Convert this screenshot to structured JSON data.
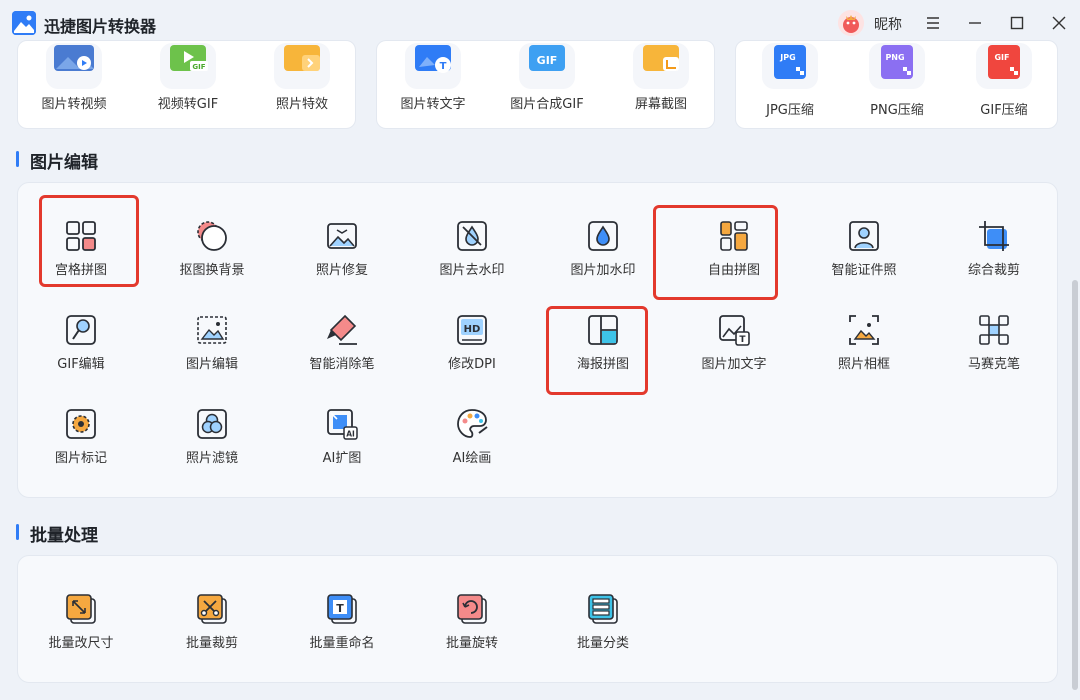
{
  "app": {
    "title": "迅捷图片转换器",
    "nickname": "昵称"
  },
  "colors": {
    "accent": "#2f7cf6",
    "highlight": "#e3392d",
    "icon_stroke": "#2b2f36",
    "icon_fill_blue": "#3e8ef7",
    "icon_fill_orange": "#f5a840",
    "icon_fill_pink": "#f48a8a"
  },
  "top_cards": [
    {
      "items": [
        {
          "label": "图片转视频",
          "icon": "video-icon"
        },
        {
          "label": "视频转GIF",
          "icon": "gif-video-icon"
        },
        {
          "label": "照片特效",
          "icon": "effect-icon"
        }
      ]
    },
    {
      "items": [
        {
          "label": "图片转文字",
          "icon": "ocr-icon"
        },
        {
          "label": "图片合成GIF",
          "icon": "gif-icon"
        },
        {
          "label": "屏幕截图",
          "icon": "screenshot-icon"
        }
      ]
    },
    {
      "items": [
        {
          "label": "JPG压缩",
          "icon": "jpg-icon"
        },
        {
          "label": "PNG压缩",
          "icon": "png-icon"
        },
        {
          "label": "GIF压缩",
          "icon": "gif-compress-icon"
        }
      ]
    }
  ],
  "edit_section": {
    "title": "图片编辑",
    "tools": [
      {
        "label": "宫格拼图",
        "icon": "grid-collage-icon"
      },
      {
        "label": "抠图换背景",
        "icon": "cutout-icon"
      },
      {
        "label": "照片修复",
        "icon": "photo-repair-icon"
      },
      {
        "label": "图片去水印",
        "icon": "remove-watermark-icon"
      },
      {
        "label": "图片加水印",
        "icon": "add-watermark-icon"
      },
      {
        "label": "自由拼图",
        "icon": "free-collage-icon"
      },
      {
        "label": "智能证件照",
        "icon": "id-photo-icon"
      },
      {
        "label": "综合裁剪",
        "icon": "crop-icon"
      },
      {
        "label": "GIF编辑",
        "icon": "gif-edit-icon"
      },
      {
        "label": "图片编辑",
        "icon": "image-edit-icon"
      },
      {
        "label": "智能消除笔",
        "icon": "eraser-pen-icon"
      },
      {
        "label": "修改DPI",
        "icon": "hd-dpi-icon"
      },
      {
        "label": "海报拼图",
        "icon": "poster-collage-icon"
      },
      {
        "label": "图片加文字",
        "icon": "add-text-icon"
      },
      {
        "label": "照片相框",
        "icon": "photo-frame-icon"
      },
      {
        "label": "马赛克笔",
        "icon": "mosaic-icon"
      },
      {
        "label": "图片标记",
        "icon": "mark-icon"
      },
      {
        "label": "照片滤镜",
        "icon": "filter-icon"
      },
      {
        "label": "AI扩图",
        "icon": "ai-expand-icon"
      },
      {
        "label": "AI绘画",
        "icon": "ai-paint-icon"
      }
    ]
  },
  "batch_section": {
    "title": "批量处理",
    "tools": [
      {
        "label": "批量改尺寸",
        "icon": "batch-resize-icon"
      },
      {
        "label": "批量裁剪",
        "icon": "batch-crop-icon"
      },
      {
        "label": "批量重命名",
        "icon": "batch-rename-icon"
      },
      {
        "label": "批量旋转",
        "icon": "batch-rotate-icon"
      },
      {
        "label": "批量分类",
        "icon": "batch-classify-icon"
      }
    ]
  }
}
